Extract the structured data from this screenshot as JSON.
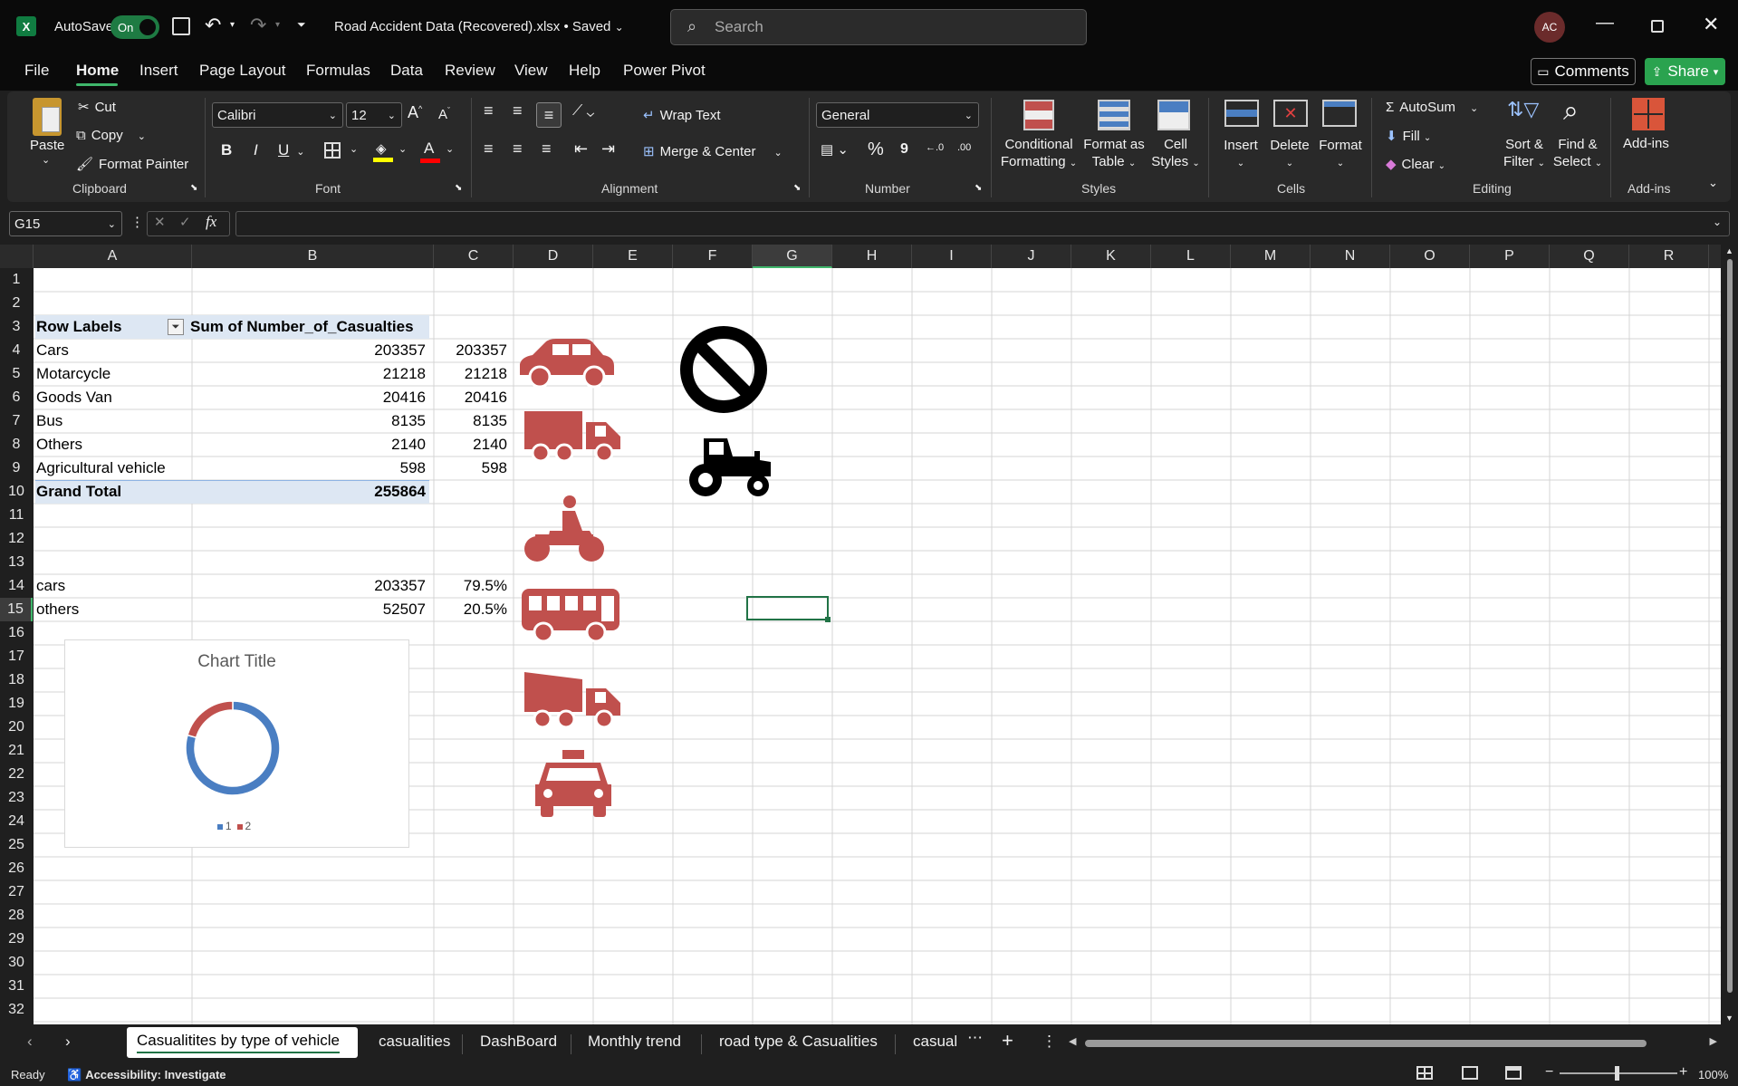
{
  "title": {
    "app_glyph": "X",
    "autosave_label": "AutoSave",
    "autosave_state": "On",
    "filename": "Road Accident Data (Recovered).xlsx • Saved",
    "search_placeholder": "Search",
    "avatar": "AC"
  },
  "menu": [
    "File",
    "Home",
    "Insert",
    "Page Layout",
    "Formulas",
    "Data",
    "Review",
    "View",
    "Help",
    "Power Pivot"
  ],
  "buttons": {
    "comments": "Comments",
    "share": "Share"
  },
  "ribbon": {
    "clipboard": {
      "paste": "Paste",
      "cut": "Cut",
      "copy": "Copy",
      "format_painter": "Format Painter",
      "label": "Clipboard"
    },
    "font": {
      "name": "Calibri",
      "size": "12",
      "bold": "B",
      "italic": "I",
      "underline": "U",
      "label": "Font"
    },
    "alignment": {
      "wrap": "Wrap Text",
      "merge": "Merge & Center",
      "label": "Alignment"
    },
    "number": {
      "format": "General",
      "percent": "%",
      "comma": "9",
      "label": "Number"
    },
    "styles": {
      "conditional_1": "Conditional",
      "conditional_2": "Formatting",
      "table_1": "Format as",
      "table_2": "Table",
      "cell_1": "Cell",
      "cell_2": "Styles",
      "label": "Styles"
    },
    "cells": {
      "insert": "Insert",
      "delete": "Delete",
      "format": "Format",
      "label": "Cells"
    },
    "editing": {
      "autosum": "AutoSum",
      "fill": "Fill",
      "clear": "Clear",
      "sort_1": "Sort &",
      "sort_2": "Filter",
      "find_1": "Find &",
      "find_2": "Select",
      "label": "Editing"
    },
    "addins": {
      "addins": "Add-ins",
      "label": "Add-ins"
    }
  },
  "formula": {
    "name_box": "G15",
    "fx": "fx",
    "content": ""
  },
  "columns": [
    "A",
    "B",
    "C",
    "D",
    "E",
    "F",
    "G",
    "H",
    "I",
    "J",
    "K",
    "L",
    "M",
    "N",
    "O",
    "P",
    "Q",
    "R"
  ],
  "rows": [
    "1",
    "2",
    "3",
    "4",
    "5",
    "6",
    "7",
    "8",
    "9",
    "10",
    "11",
    "12",
    "13",
    "14",
    "15",
    "16",
    "17",
    "18",
    "19",
    "20",
    "21",
    "22",
    "23",
    "24",
    "25",
    "26",
    "27",
    "28",
    "29",
    "30",
    "31",
    "32"
  ],
  "pivot": {
    "header_labels": "Row Labels",
    "header_sum": "Sum of Number_of_Casualties",
    "rows": [
      {
        "label": "Cars",
        "value": "203357",
        "c": "203357"
      },
      {
        "label": "Motarcycle",
        "value": "21218",
        "c": "21218"
      },
      {
        "label": "Goods Van",
        "value": "20416",
        "c": "20416"
      },
      {
        "label": "Bus",
        "value": "8135",
        "c": "8135"
      },
      {
        "label": "Others",
        "value": "2140",
        "c": "2140"
      },
      {
        "label": "Agricultural vehicle",
        "value": "598",
        "c": "598"
      }
    ],
    "grand_label": "Grand Total",
    "grand_value": "255864"
  },
  "summary": [
    {
      "label": "cars",
      "value": "203357",
      "pct": "79.5%"
    },
    {
      "label": "others",
      "value": "52507",
      "pct": "20.5%"
    }
  ],
  "chart_data": {
    "type": "pie",
    "title": "Chart Title",
    "categories": [
      "1",
      "2"
    ],
    "values": [
      203357,
      52507
    ],
    "colors": [
      "#4a7ec2",
      "#c0504d"
    ],
    "legend": "bottom"
  },
  "colors": {
    "icon_red": "#c0504d",
    "accent_green": "#217346"
  },
  "icons": [
    "car-icon",
    "truck-icon",
    "motorcycle-icon",
    "bus-icon",
    "dump-truck-icon",
    "taxi-icon",
    "no-entry-icon",
    "tractor-icon"
  ],
  "sheets": [
    "Casualitites by type of vehicle",
    "casualities",
    "DashBoard",
    "Monthly trend",
    "road type & Casualities",
    "casual"
  ],
  "status": {
    "ready": "Ready",
    "accessibility": "Accessibility: Investigate",
    "zoom": "100%"
  }
}
